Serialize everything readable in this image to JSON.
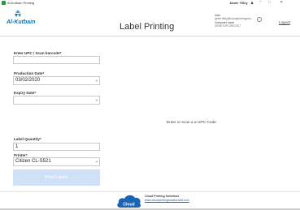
{
  "window": {
    "title": "Al-Kutbain Printing",
    "user_name": "Jamie Tilley",
    "minimize_icon": "minimize-icon",
    "maximize_icon": "maximize-icon",
    "close_icon": "close-icon"
  },
  "header": {
    "logo_text": "Al-Kutbain",
    "page_title": "Label Printing",
    "user_label": "User",
    "user_email": "jamie.tilley@cloudprintingsolu...",
    "computer_label": "Computer name",
    "computer_name": "DESKTOP-OEK2207",
    "logout": "Logout"
  },
  "form": {
    "upc_label": "Enter UPC / Scan barcode*",
    "upc_value": "",
    "production_label": "Production Date*",
    "production_value": "03/02/2020",
    "expiry_label": "Expiry Date*",
    "expiry_value": "",
    "hint": "Enter or scan a a UPC Code",
    "quantity_label": "Label Quantity*",
    "quantity_value": "1",
    "printer_label": "Printer*",
    "printer_value": "Citizen CL-S521",
    "print_button": "Print Labels"
  },
  "footer": {
    "cloud_text": "Cloud",
    "title": "Cloud Printing Solutions",
    "link": "www.cloudprintingsolutionsltd.com"
  },
  "colors": {
    "accent": "#0a74b8",
    "button_disabled": "#cfe0f7",
    "cloud": "#1b63b5"
  }
}
